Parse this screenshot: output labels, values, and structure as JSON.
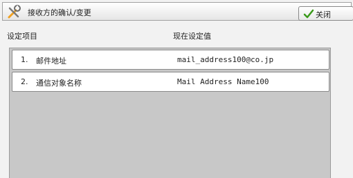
{
  "window": {
    "title": "接收方的确认/变更",
    "icon": "tools-icon",
    "close_label": "关闭",
    "close_icon": "checkmark-icon"
  },
  "columns": {
    "item_header": "设定项目",
    "value_header": "现在设定值"
  },
  "rows": [
    {
      "number": "1.",
      "label": "邮件地址",
      "value": "mail_address100@co.jp"
    },
    {
      "number": "2.",
      "label": "通信对象名称",
      "value": "Mail Address Name100"
    }
  ],
  "colors": {
    "panel_background": "#c8c8c8",
    "row_background": "#ffffff",
    "checkmark_green": "#3a9a1a"
  }
}
